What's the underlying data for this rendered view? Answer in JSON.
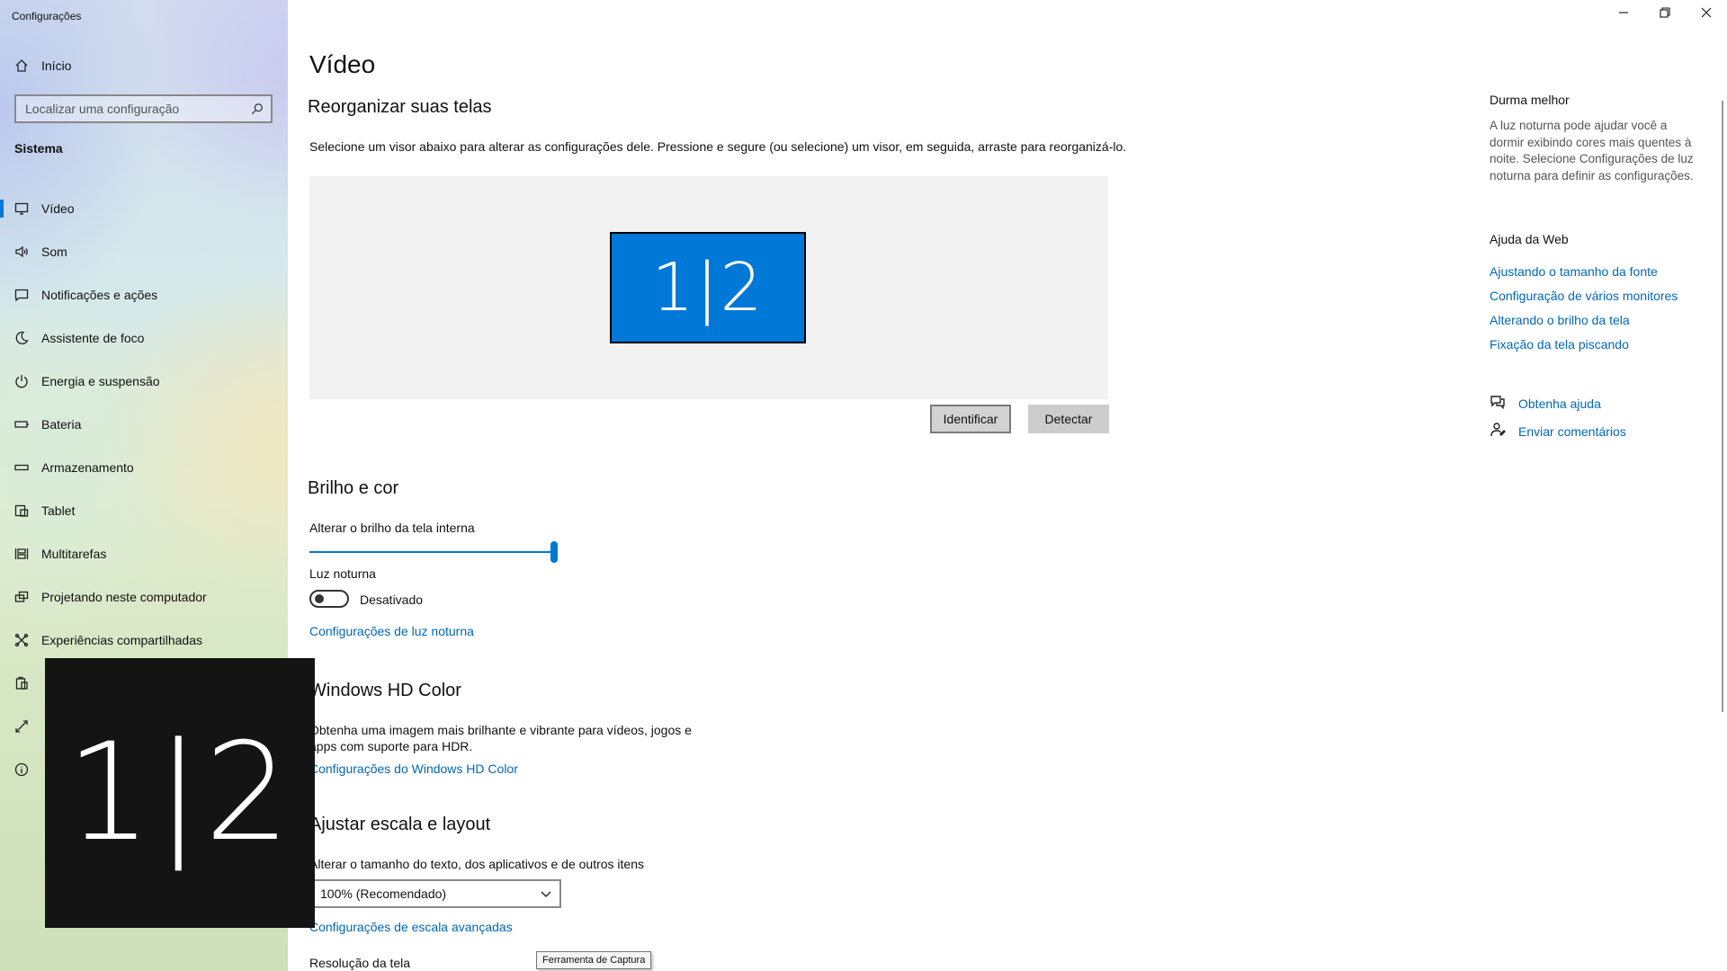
{
  "window": {
    "title": "Configurações",
    "controls": {
      "minimize_icon": "minimize-icon",
      "restore_icon": "restore-icon",
      "close_icon": "close-icon"
    }
  },
  "sidebar": {
    "home_label": "Início",
    "search_placeholder": "Localizar uma configuração",
    "section_title": "Sistema",
    "items": [
      {
        "label": "Vídeo",
        "icon": "monitor-icon",
        "active": true
      },
      {
        "label": "Som",
        "icon": "speaker-icon"
      },
      {
        "label": "Notificações e ações",
        "icon": "notification-icon"
      },
      {
        "label": "Assistente de foco",
        "icon": "moon-icon"
      },
      {
        "label": "Energia e suspensão",
        "icon": "power-icon"
      },
      {
        "label": "Bateria",
        "icon": "battery-icon"
      },
      {
        "label": "Armazenamento",
        "icon": "storage-icon"
      },
      {
        "label": "Tablet",
        "icon": "tablet-icon"
      },
      {
        "label": "Multitarefas",
        "icon": "multitasking-icon"
      },
      {
        "label": "Projetando neste computador",
        "icon": "projector-icon"
      },
      {
        "label": "Experiências compartilhadas",
        "icon": "shared-icon"
      },
      {
        "label": "",
        "icon": "clipboard-icon"
      },
      {
        "label": "",
        "icon": "remote-icon"
      },
      {
        "label": "",
        "icon": "info-icon"
      }
    ]
  },
  "main": {
    "page_title": "Vídeo",
    "arrange": {
      "heading": "Reorganizar suas telas",
      "description": "Selecione um visor abaixo para alterar as configurações dele. Pressione e segure (ou selecione) um visor, em seguida, arraste para reorganizá-lo.",
      "monitor_label": "1|2",
      "identify_label": "Identificar",
      "detect_label": "Detectar"
    },
    "brightness": {
      "heading": "Brilho e cor",
      "slider_label": "Alterar o brilho da tela interna",
      "slider_value": 100,
      "night_light_label": "Luz noturna",
      "night_light_state": "Desativado",
      "night_light_link": "Configurações de luz noturna"
    },
    "hdr": {
      "heading": "Windows HD Color",
      "description": "Obtenha uma imagem mais brilhante e vibrante para vídeos, jogos e apps com suporte para HDR.",
      "link": "Configurações do Windows HD Color"
    },
    "scale": {
      "heading": "Ajustar escala e layout",
      "label": "Alterar o tamanho do texto, dos aplicativos e de outros itens",
      "selected": "100% (Recomendado)",
      "advanced_link": "Configurações de escala avançadas",
      "resolution_label": "Resolução da tela"
    }
  },
  "right_panel": {
    "sleep_title": "Durma melhor",
    "sleep_text": "A luz noturna pode ajudar você a dormir exibindo cores mais quentes à noite. Selecione Configurações de luz noturna para definir as configurações.",
    "web_help_title": "Ajuda da Web",
    "web_links": [
      "Ajustando o tamanho da fonte",
      "Configuração de vários monitores",
      "Alterando o brilho da tela",
      "Fixação da tela piscando"
    ],
    "get_help": "Obtenha ajuda",
    "feedback": "Enviar comentários"
  },
  "overlay": {
    "identify_number": "1|2"
  },
  "tooltip": {
    "text": "Ferramenta de Captura"
  },
  "colors": {
    "accent": "#0078d7",
    "link": "#0067b8"
  }
}
